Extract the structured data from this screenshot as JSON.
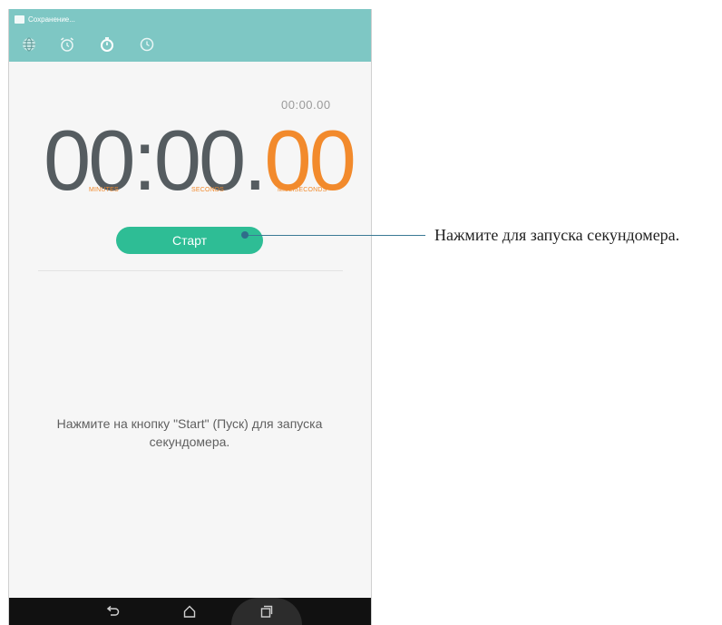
{
  "status_bar": {
    "notification": "Сохранение..."
  },
  "tabs": [
    {
      "name": "world-clock",
      "icon": "globe-icon"
    },
    {
      "name": "alarm",
      "icon": "alarm-clock-icon"
    },
    {
      "name": "stopwatch",
      "icon": "stopwatch-icon",
      "active": true
    },
    {
      "name": "timer",
      "icon": "timer-icon"
    }
  ],
  "stopwatch": {
    "lap_time": "00:00.00",
    "minutes": "00",
    "seconds": "00",
    "milliseconds": "00",
    "label_minutes": "MINUTES",
    "label_seconds": "SECONDS",
    "label_milliseconds": "MILLISECONDS",
    "start_label": "Старт",
    "hint": "Нажмите на кнопку \"Start\" (Пуск) для запуска секундомера."
  },
  "callout": {
    "text": "Нажмите для запуска секундомера."
  },
  "colors": {
    "topbar": "#7ec7c4",
    "accent_orange": "#f28a2c",
    "start_button": "#2ebd95",
    "callout_line": "#3a7a95"
  }
}
